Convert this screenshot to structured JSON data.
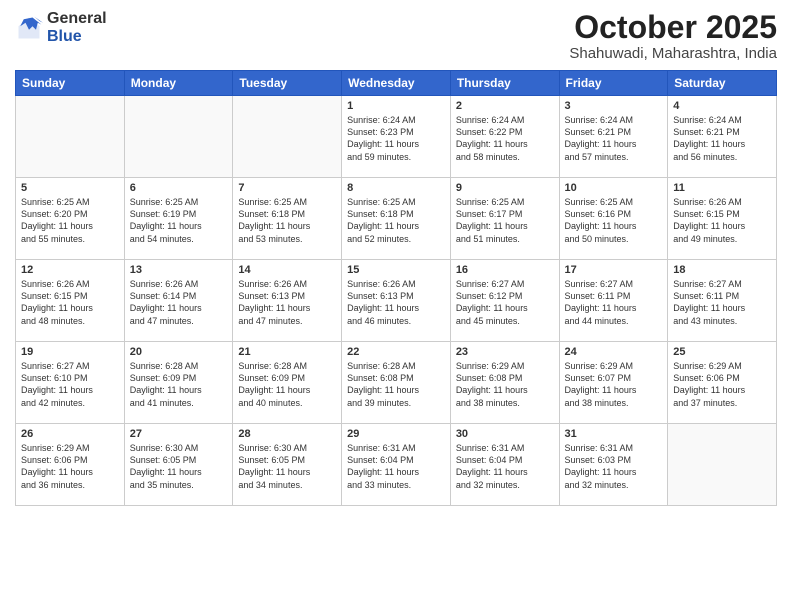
{
  "header": {
    "logo_general": "General",
    "logo_blue": "Blue",
    "month_title": "October 2025",
    "location": "Shahuwadi, Maharashtra, India"
  },
  "weekdays": [
    "Sunday",
    "Monday",
    "Tuesday",
    "Wednesday",
    "Thursday",
    "Friday",
    "Saturday"
  ],
  "weeks": [
    [
      {
        "day": "",
        "info": ""
      },
      {
        "day": "",
        "info": ""
      },
      {
        "day": "",
        "info": ""
      },
      {
        "day": "1",
        "info": "Sunrise: 6:24 AM\nSunset: 6:23 PM\nDaylight: 11 hours\nand 59 minutes."
      },
      {
        "day": "2",
        "info": "Sunrise: 6:24 AM\nSunset: 6:22 PM\nDaylight: 11 hours\nand 58 minutes."
      },
      {
        "day": "3",
        "info": "Sunrise: 6:24 AM\nSunset: 6:21 PM\nDaylight: 11 hours\nand 57 minutes."
      },
      {
        "day": "4",
        "info": "Sunrise: 6:24 AM\nSunset: 6:21 PM\nDaylight: 11 hours\nand 56 minutes."
      }
    ],
    [
      {
        "day": "5",
        "info": "Sunrise: 6:25 AM\nSunset: 6:20 PM\nDaylight: 11 hours\nand 55 minutes."
      },
      {
        "day": "6",
        "info": "Sunrise: 6:25 AM\nSunset: 6:19 PM\nDaylight: 11 hours\nand 54 minutes."
      },
      {
        "day": "7",
        "info": "Sunrise: 6:25 AM\nSunset: 6:18 PM\nDaylight: 11 hours\nand 53 minutes."
      },
      {
        "day": "8",
        "info": "Sunrise: 6:25 AM\nSunset: 6:18 PM\nDaylight: 11 hours\nand 52 minutes."
      },
      {
        "day": "9",
        "info": "Sunrise: 6:25 AM\nSunset: 6:17 PM\nDaylight: 11 hours\nand 51 minutes."
      },
      {
        "day": "10",
        "info": "Sunrise: 6:25 AM\nSunset: 6:16 PM\nDaylight: 11 hours\nand 50 minutes."
      },
      {
        "day": "11",
        "info": "Sunrise: 6:26 AM\nSunset: 6:15 PM\nDaylight: 11 hours\nand 49 minutes."
      }
    ],
    [
      {
        "day": "12",
        "info": "Sunrise: 6:26 AM\nSunset: 6:15 PM\nDaylight: 11 hours\nand 48 minutes."
      },
      {
        "day": "13",
        "info": "Sunrise: 6:26 AM\nSunset: 6:14 PM\nDaylight: 11 hours\nand 47 minutes."
      },
      {
        "day": "14",
        "info": "Sunrise: 6:26 AM\nSunset: 6:13 PM\nDaylight: 11 hours\nand 47 minutes."
      },
      {
        "day": "15",
        "info": "Sunrise: 6:26 AM\nSunset: 6:13 PM\nDaylight: 11 hours\nand 46 minutes."
      },
      {
        "day": "16",
        "info": "Sunrise: 6:27 AM\nSunset: 6:12 PM\nDaylight: 11 hours\nand 45 minutes."
      },
      {
        "day": "17",
        "info": "Sunrise: 6:27 AM\nSunset: 6:11 PM\nDaylight: 11 hours\nand 44 minutes."
      },
      {
        "day": "18",
        "info": "Sunrise: 6:27 AM\nSunset: 6:11 PM\nDaylight: 11 hours\nand 43 minutes."
      }
    ],
    [
      {
        "day": "19",
        "info": "Sunrise: 6:27 AM\nSunset: 6:10 PM\nDaylight: 11 hours\nand 42 minutes."
      },
      {
        "day": "20",
        "info": "Sunrise: 6:28 AM\nSunset: 6:09 PM\nDaylight: 11 hours\nand 41 minutes."
      },
      {
        "day": "21",
        "info": "Sunrise: 6:28 AM\nSunset: 6:09 PM\nDaylight: 11 hours\nand 40 minutes."
      },
      {
        "day": "22",
        "info": "Sunrise: 6:28 AM\nSunset: 6:08 PM\nDaylight: 11 hours\nand 39 minutes."
      },
      {
        "day": "23",
        "info": "Sunrise: 6:29 AM\nSunset: 6:08 PM\nDaylight: 11 hours\nand 38 minutes."
      },
      {
        "day": "24",
        "info": "Sunrise: 6:29 AM\nSunset: 6:07 PM\nDaylight: 11 hours\nand 38 minutes."
      },
      {
        "day": "25",
        "info": "Sunrise: 6:29 AM\nSunset: 6:06 PM\nDaylight: 11 hours\nand 37 minutes."
      }
    ],
    [
      {
        "day": "26",
        "info": "Sunrise: 6:29 AM\nSunset: 6:06 PM\nDaylight: 11 hours\nand 36 minutes."
      },
      {
        "day": "27",
        "info": "Sunrise: 6:30 AM\nSunset: 6:05 PM\nDaylight: 11 hours\nand 35 minutes."
      },
      {
        "day": "28",
        "info": "Sunrise: 6:30 AM\nSunset: 6:05 PM\nDaylight: 11 hours\nand 34 minutes."
      },
      {
        "day": "29",
        "info": "Sunrise: 6:31 AM\nSunset: 6:04 PM\nDaylight: 11 hours\nand 33 minutes."
      },
      {
        "day": "30",
        "info": "Sunrise: 6:31 AM\nSunset: 6:04 PM\nDaylight: 11 hours\nand 32 minutes."
      },
      {
        "day": "31",
        "info": "Sunrise: 6:31 AM\nSunset: 6:03 PM\nDaylight: 11 hours\nand 32 minutes."
      },
      {
        "day": "",
        "info": ""
      }
    ]
  ]
}
